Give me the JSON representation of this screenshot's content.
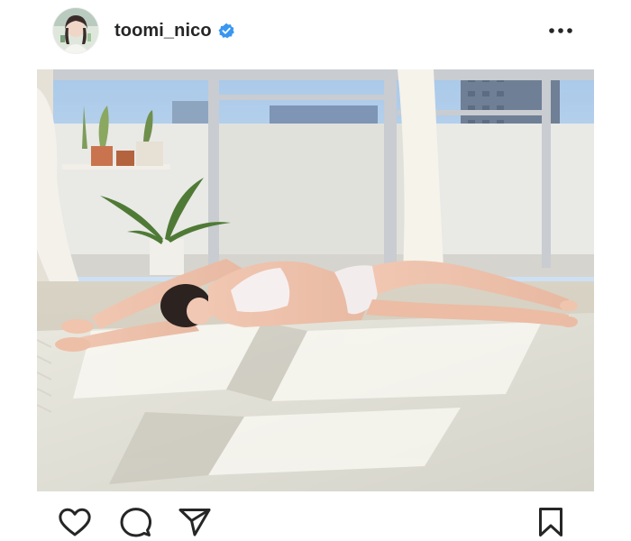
{
  "post": {
    "username": "toomi_nico",
    "verified": true,
    "avatar_icon": "profile-avatar",
    "more_icon": "more-horizontal-icon",
    "photo_icon": "post-photo",
    "actions": {
      "like_icon": "heart-icon",
      "comment_icon": "comment-icon",
      "share_icon": "paper-plane-icon",
      "save_icon": "bookmark-icon"
    }
  },
  "colors": {
    "text": "#262626",
    "verified_blue": "#3897f0",
    "background": "#ffffff"
  }
}
